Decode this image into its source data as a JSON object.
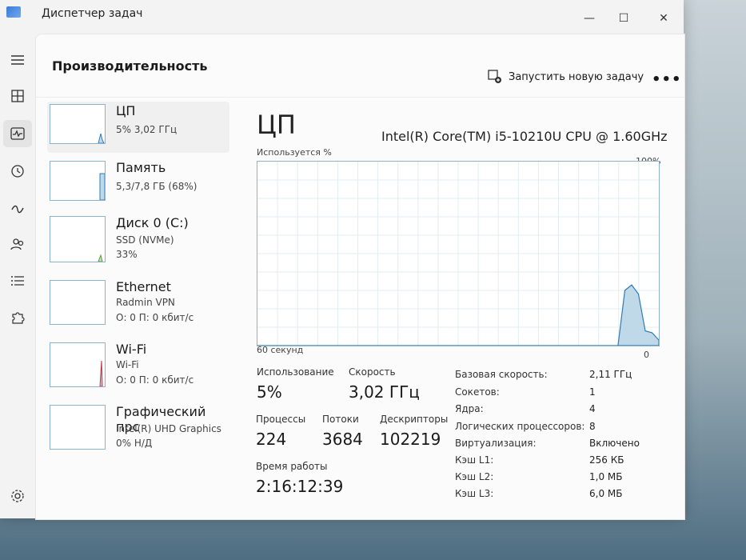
{
  "window": {
    "title": "Диспетчер задач",
    "minimize": "—",
    "maximize": "☐",
    "close": "✕"
  },
  "header": {
    "title": "Производительность",
    "run_task": "Запустить новую задачу",
    "more": "•••"
  },
  "devices": [
    {
      "name": "ЦП",
      "line1": "5% 3,02 ГГц",
      "line2": ""
    },
    {
      "name": "Память",
      "line1": "5,3/7,8 ГБ (68%)",
      "line2": ""
    },
    {
      "name": "Диск 0 (C:)",
      "line1": "SSD (NVMe)",
      "line2": "33%"
    },
    {
      "name": "Ethernet",
      "line1": "Radmin VPN",
      "line2": "О: 0 П: 0 кбит/с"
    },
    {
      "name": "Wi-Fi",
      "line1": "Wi-Fi",
      "line2": "О: 0 П: 0 кбит/с"
    },
    {
      "name": "Графический прс",
      "line1": "Intel(R) UHD Graphics",
      "line2": "0% Н/Д"
    }
  ],
  "cpu": {
    "title": "ЦП",
    "model": "Intel(R) Core(TM) i5-10210U CPU @ 1.60GHz",
    "graph_label": "Используется %",
    "graph_max": "100%",
    "graph_time": "60 секунд",
    "graph_min": "0"
  },
  "stats": {
    "usage_label": "Использование",
    "usage_value": "5%",
    "speed_label": "Скорость",
    "speed_value": "3,02 ГГц",
    "processes_label": "Процессы",
    "processes_value": "224",
    "threads_label": "Потоки",
    "threads_value": "3684",
    "handles_label": "Дескрипторы",
    "handles_value": "102219",
    "uptime_label": "Время работы",
    "uptime_value": "2:16:12:39"
  },
  "details": [
    {
      "label": "Базовая скорость:",
      "value": "2,11 ГГц"
    },
    {
      "label": "Сокетов:",
      "value": "1"
    },
    {
      "label": "Ядра:",
      "value": "4"
    },
    {
      "label": "Логических процессоров:",
      "value": "8"
    },
    {
      "label": "Виртуализация:",
      "value": "Включено"
    },
    {
      "label": "Кэш L1:",
      "value": "256 КБ"
    },
    {
      "label": "Кэш L2:",
      "value": "1,0 МБ"
    },
    {
      "label": "Кэш L3:",
      "value": "6,0 МБ"
    }
  ],
  "chart_data": {
    "type": "area",
    "ylim": [
      0,
      100
    ],
    "series": [
      {
        "values": [
          0,
          0,
          0,
          0,
          0,
          0,
          0,
          0,
          0,
          0,
          0,
          0,
          0,
          0,
          0,
          0,
          0,
          0,
          0,
          0,
          0,
          0,
          0,
          0,
          0,
          0,
          0,
          0,
          0,
          0,
          0,
          0,
          0,
          0,
          0,
          0,
          0,
          0,
          0,
          0,
          0,
          0,
          0,
          0,
          0,
          0,
          0,
          0,
          0,
          0,
          0,
          0,
          0,
          0,
          30,
          33,
          28,
          8,
          7,
          3
        ]
      }
    ]
  },
  "colors": {
    "accent": "#2e7cb8",
    "chart_border": "#8db3c8",
    "chart_fill": "#bfd9e8",
    "grid": "#e3ecf1"
  }
}
